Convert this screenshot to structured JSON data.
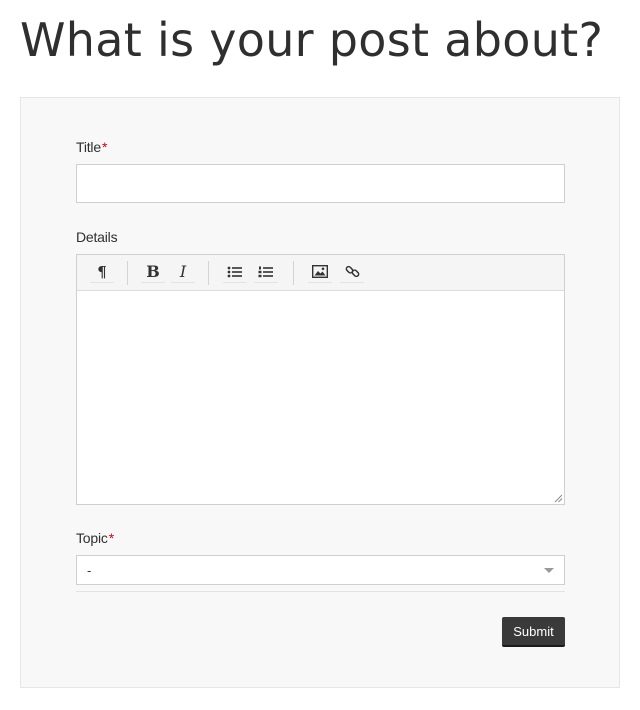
{
  "page": {
    "title": "What is your post about?"
  },
  "form": {
    "title_field": {
      "label": "Title",
      "required_mark": "*",
      "value": "",
      "placeholder": ""
    },
    "details_field": {
      "label": "Details",
      "value": "",
      "toolbar": {
        "paragraph_glyph": "¶",
        "bold_glyph": "B",
        "italic_glyph": "I",
        "icons": [
          "paragraph-icon",
          "bold-icon",
          "italic-icon",
          "bulleted-list-icon",
          "numbered-list-icon",
          "image-icon",
          "link-icon"
        ]
      }
    },
    "topic_field": {
      "label": "Topic",
      "required_mark": "*",
      "selected_value": "-"
    },
    "submit_label": "Submit"
  },
  "colors": {
    "required": "#d0021b",
    "panel_background": "#f8f8f8",
    "submit_background": "#3a3a3a"
  }
}
